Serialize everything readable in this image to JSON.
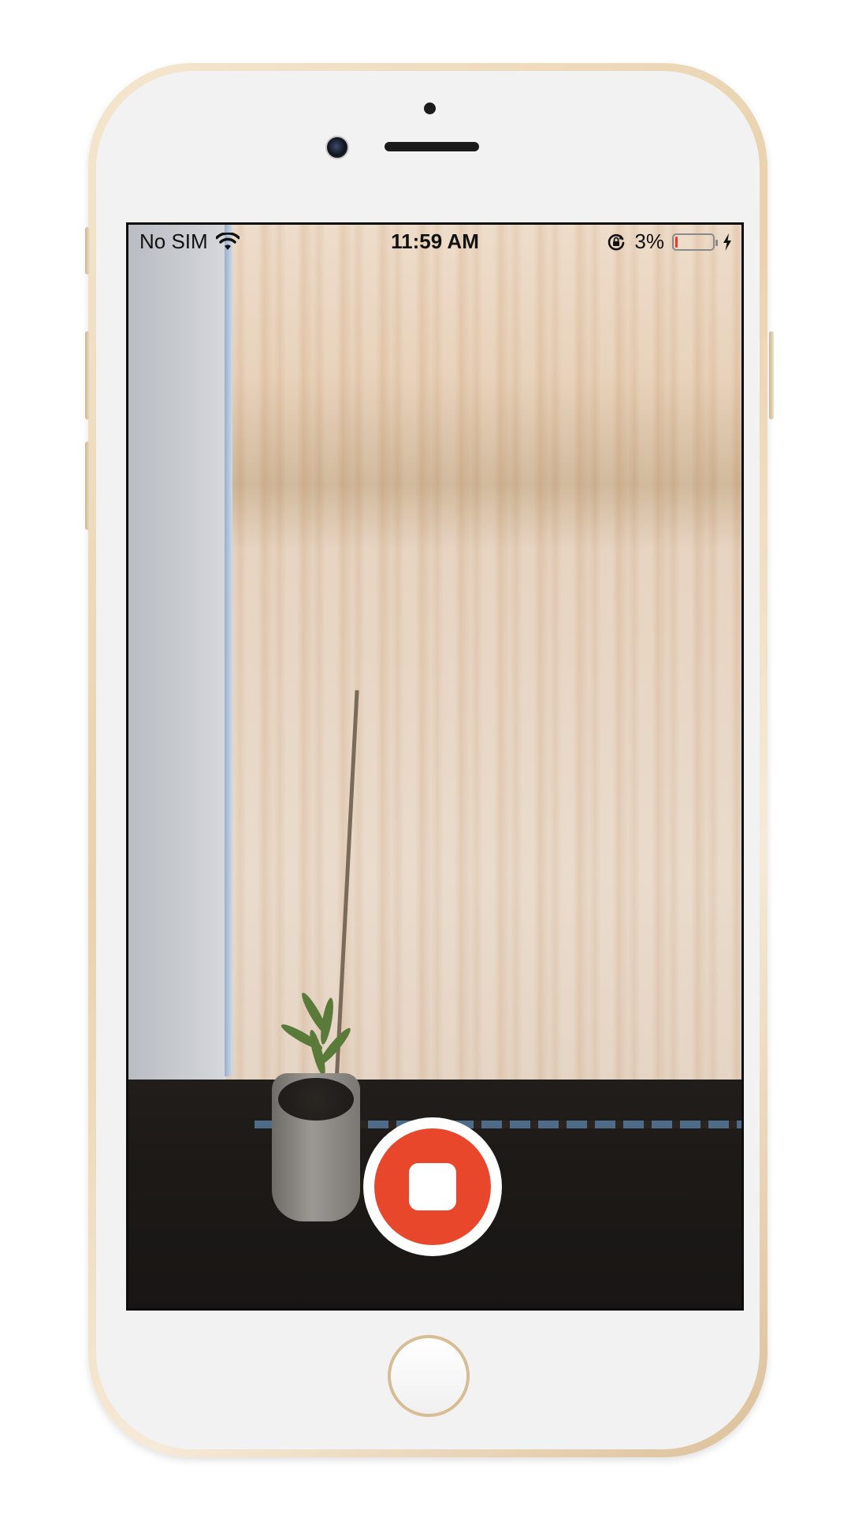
{
  "status_bar": {
    "carrier": "No SIM",
    "time": "11:59 AM",
    "battery_percent": "3%",
    "battery_level": 0.03
  },
  "camera": {
    "mode": "recording",
    "record_button_state": "stop"
  },
  "icons": {
    "wifi": "wifi-icon",
    "rotation_lock": "rotation-lock-icon",
    "battery": "battery-icon",
    "charging": "charging-bolt-icon",
    "stop": "stop-icon"
  },
  "colors": {
    "record_red": "#E8472B",
    "battery_low": "#E53935",
    "phone_gold": "#E9D2AD",
    "control_bar": "#1A1A1A"
  }
}
